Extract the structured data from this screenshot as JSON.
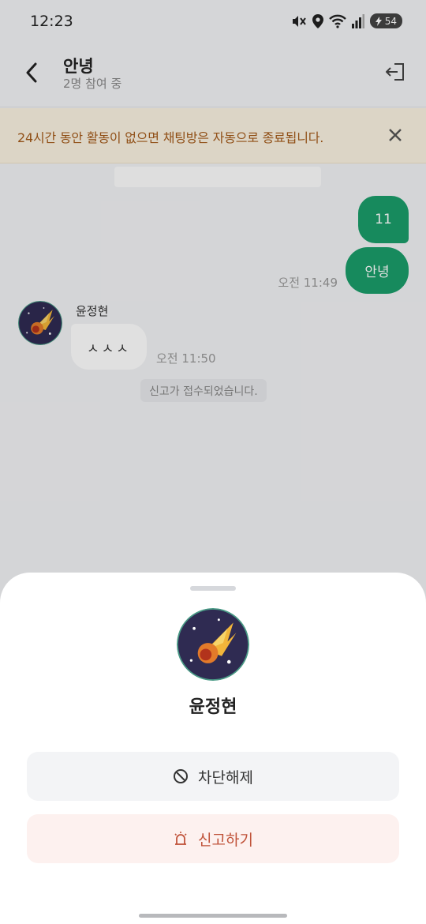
{
  "status_bar": {
    "time": "12:23",
    "battery": "54"
  },
  "header": {
    "title": "안녕",
    "subtitle": "2명 참여 중"
  },
  "banner": {
    "text": "24시간 동안 활동이 없으면 채팅방은 자동으로 종료됩니다."
  },
  "messages": {
    "outgoing": [
      {
        "text": "11"
      },
      {
        "text": "안녕"
      }
    ],
    "outgoing_time": "오전 11:49",
    "incoming": {
      "sender": "윤정현",
      "text": "ㅅㅅㅅ",
      "time": "오전 11:50"
    },
    "system": "신고가 접수되었습니다."
  },
  "sheet": {
    "name": "윤정현",
    "unblock_label": "차단해제",
    "report_label": "신고하기"
  },
  "colors": {
    "accent_green": "#1b9e6a",
    "banner_text": "#a45a1a",
    "report_text": "#c0533a"
  },
  "icons": [
    "mute-icon",
    "location-icon",
    "wifi-icon",
    "signal-icon",
    "battery-icon",
    "back-arrow-icon",
    "exit-icon",
    "close-icon",
    "block-icon",
    "alarm-siren-icon"
  ]
}
